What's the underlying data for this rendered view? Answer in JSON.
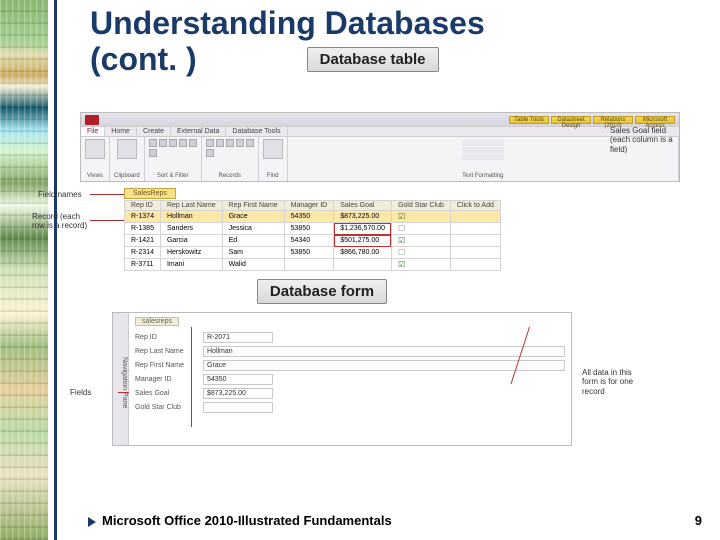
{
  "slide": {
    "title_line1": "Understanding Databases",
    "title_line2": "(cont. )",
    "callout_table": "Database table",
    "callout_form": "Database form",
    "footer_text": "Microsoft Office 2010-Illustrated Fundamentals",
    "page_number": "9"
  },
  "table_shot": {
    "tabs": [
      "File",
      "Home",
      "Create",
      "External Data",
      "Database Tools"
    ],
    "tool_tabs": [
      "Table Tools",
      "Datasheet Design",
      "Relations (2010)",
      "Microsoft Access"
    ],
    "rib_groups": [
      "Views",
      "Clipboard",
      "Sort & Filter",
      "Records",
      "Find",
      "Text Formatting"
    ],
    "datasheet_tab": "SalesReps",
    "columns": [
      "Rep ID",
      "Rep Last Name",
      "Rep First Name",
      "Manager ID",
      "Sales Goal",
      "Gold Star Club",
      "Click to Add"
    ],
    "rows": [
      {
        "id": "R-1374",
        "last": "Hollman",
        "first": "Grace",
        "mgr": "54350",
        "goal": "$873,225.00",
        "club": true
      },
      {
        "id": "R-1385",
        "last": "Sanders",
        "first": "Jessica",
        "mgr": "53850",
        "goal": "$1,236,570.00",
        "club": false
      },
      {
        "id": "R-1421",
        "last": "Garcia",
        "first": "Ed",
        "mgr": "54340",
        "goal": "$501,275.00",
        "club": true
      },
      {
        "id": "R-2314",
        "last": "Herskowitz",
        "first": "Sam",
        "mgr": "53850",
        "goal": "$866,780.00",
        "club": false
      },
      {
        "id": "R-3711",
        "last": "Imani",
        "first": "Walid",
        "mgr": "",
        "goal": "",
        "club": true
      }
    ],
    "annot_fieldnames": "Field names",
    "annot_record": "Record (each row is a record)",
    "annot_salesgoal": "Sales Goal field (each column is a field)"
  },
  "form_shot": {
    "nav_label": "Navigation Pane",
    "form_tab": "salesreps",
    "fields": [
      {
        "label": "Rep ID",
        "value": "R-2071"
      },
      {
        "label": "Rep Last Name",
        "value": "Hollman"
      },
      {
        "label": "Rep First Name",
        "value": "Grace"
      },
      {
        "label": "Manager ID",
        "value": "54350"
      },
      {
        "label": "Sales Goal",
        "value": "$873,225.00"
      },
      {
        "label": "Gold Star Club",
        "value": ""
      }
    ],
    "annot_fields": "Fields",
    "annot_allrec": "All data in this form is for one record"
  }
}
